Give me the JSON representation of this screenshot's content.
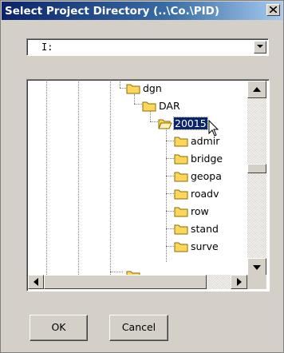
{
  "window": {
    "title": "Select Project Directory (..\\Co.\\PID)"
  },
  "drive_select": {
    "value": "I:"
  },
  "tree": {
    "items": [
      {
        "label": "dgn",
        "depth": 0
      },
      {
        "label": "DAR",
        "depth": 1
      },
      {
        "label": "20015",
        "depth": 2,
        "selected": true
      },
      {
        "label": "admir",
        "depth": 3
      },
      {
        "label": "bridge",
        "depth": 3
      },
      {
        "label": "geopa",
        "depth": 3
      },
      {
        "label": "roadv",
        "depth": 3
      },
      {
        "label": "row",
        "depth": 3
      },
      {
        "label": "stand",
        "depth": 3
      },
      {
        "label": "surve",
        "depth": 3
      }
    ]
  },
  "buttons": {
    "ok": "OK",
    "cancel": "Cancel"
  },
  "colors": {
    "title_bar_start": "#0a246a",
    "title_bar_end": "#a6caf0",
    "face": "#d4d0c8",
    "selection": "#0a246a",
    "folder": "#ffd65c"
  }
}
